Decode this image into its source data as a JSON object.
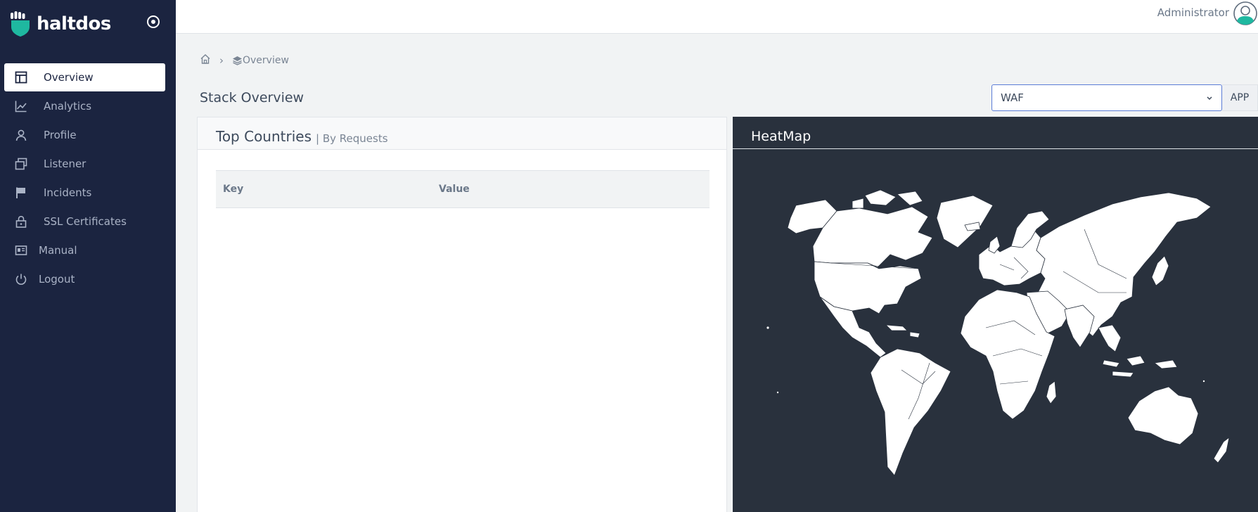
{
  "brand": {
    "name": "haltdos",
    "logo_icon": "fist-shield-icon",
    "accent": "#1fb8a0"
  },
  "sidebar": {
    "toggle_icon": "target-icon",
    "items": [
      {
        "label": "Overview",
        "icon": "layout-icon",
        "active": true
      },
      {
        "label": "Analytics",
        "icon": "chart-line-icon",
        "active": false
      },
      {
        "label": "Profile",
        "icon": "user-icon",
        "active": false
      },
      {
        "label": "Listener",
        "icon": "windows-icon",
        "active": false
      },
      {
        "label": "Incidents",
        "icon": "flag-icon",
        "active": false
      },
      {
        "label": "SSL Certificates",
        "icon": "lock-icon",
        "active": false
      },
      {
        "label": "Manual",
        "icon": "book-icon",
        "active": false
      },
      {
        "label": "Logout",
        "icon": "power-icon",
        "active": false
      }
    ]
  },
  "topbar": {
    "user_name": "Administrator",
    "avatar_icon": "user-circle-icon"
  },
  "breadcrumb": {
    "home_icon": "home-icon",
    "separator": "›",
    "current": "Overview",
    "current_icon": "layers-icon"
  },
  "page": {
    "title": "Stack Overview"
  },
  "stack_select": {
    "value": "WAF",
    "button": "APP"
  },
  "countries_card": {
    "title": "Top Countries",
    "subtitle": "| By Requests",
    "columns": [
      "Key",
      "Value"
    ],
    "rows": []
  },
  "heatmap_card": {
    "title": "HeatMap",
    "background": "#29313d",
    "land_color": "#ffffff"
  },
  "colors": {
    "sidebar_bg": "#1b2440",
    "select_border": "#5b7cd6"
  }
}
